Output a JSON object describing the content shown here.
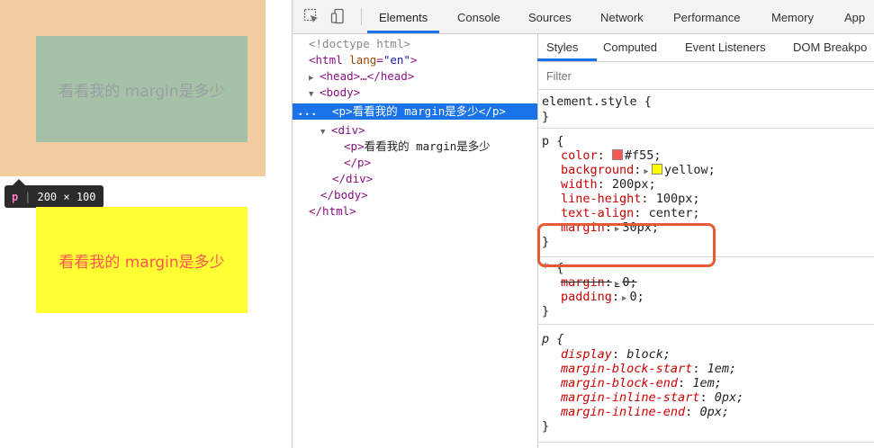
{
  "page": {
    "element_text": "看看我的 margin是多少",
    "tooltip": {
      "tag": "p",
      "separator": "|",
      "size": "200 × 100"
    },
    "colors": {
      "margin": "#f2cb9e",
      "content": "#a5c2a8",
      "p_background": "#ffff33",
      "p_text": "#ff5555"
    }
  },
  "devtools": {
    "toolbar": {
      "icons": [
        "inspect-icon",
        "device-toolbar-icon"
      ],
      "tabs": [
        "Elements",
        "Console",
        "Sources",
        "Network",
        "Performance",
        "Memory",
        "App"
      ],
      "active_tab": "Elements"
    },
    "dom_tree": {
      "doctype": "<!doctype html>",
      "html_open": "<html",
      "html_attr_name": "lang",
      "html_attr_eq": "=",
      "html_attr_value": "\"en\"",
      "html_gt": ">",
      "head": "<head>…</head>",
      "body_open": "<body>",
      "selected_dots": "...",
      "p_open": "<p>",
      "p_text": "看看我的 margin是多少",
      "p_close": "</p>",
      "div_open": "<div>",
      "inner_p_open": "<p>",
      "inner_p_text": "看看我的 margin是多少",
      "inner_p_close": "</p>",
      "div_close": "</div>",
      "body_close": "</body>",
      "html_close": "</html>"
    },
    "styles": {
      "sub_tabs": [
        "Styles",
        "Computed",
        "Event Listeners",
        "DOM Breakpo"
      ],
      "filter_placeholder": "Filter",
      "element_style": {
        "selector": "element.style {",
        "close": "}"
      },
      "rule_p": {
        "selector": "p {",
        "decls": [
          {
            "prop": "color",
            "value": "#f55;",
            "swatch": "#ff5555"
          },
          {
            "prop": "background",
            "value": "yellow;",
            "swatch": "#ffff00"
          },
          {
            "prop": "width",
            "value": "200px;"
          },
          {
            "prop": "line-height",
            "value": "100px;"
          },
          {
            "prop": "text-align",
            "value": "center;"
          },
          {
            "prop": "margin",
            "value": "30px;"
          }
        ],
        "close": "}"
      },
      "rule_star": {
        "selector": "* {",
        "decls": [
          {
            "prop": "margin",
            "value": "0;"
          },
          {
            "prop": "padding",
            "value": "0;"
          }
        ],
        "close": "}"
      },
      "rule_ua": {
        "selector": "p {",
        "decls": [
          {
            "prop": "display",
            "value": "block;"
          },
          {
            "prop": "margin-block-start",
            "value": "1em;"
          },
          {
            "prop": "margin-block-end",
            "value": "1em;"
          },
          {
            "prop": "margin-inline-start",
            "value": "0px;"
          },
          {
            "prop": "margin-inline-end",
            "value": "0px;"
          }
        ],
        "close": "}"
      },
      "colon": ":",
      "expand_arrow": "▶"
    }
  }
}
